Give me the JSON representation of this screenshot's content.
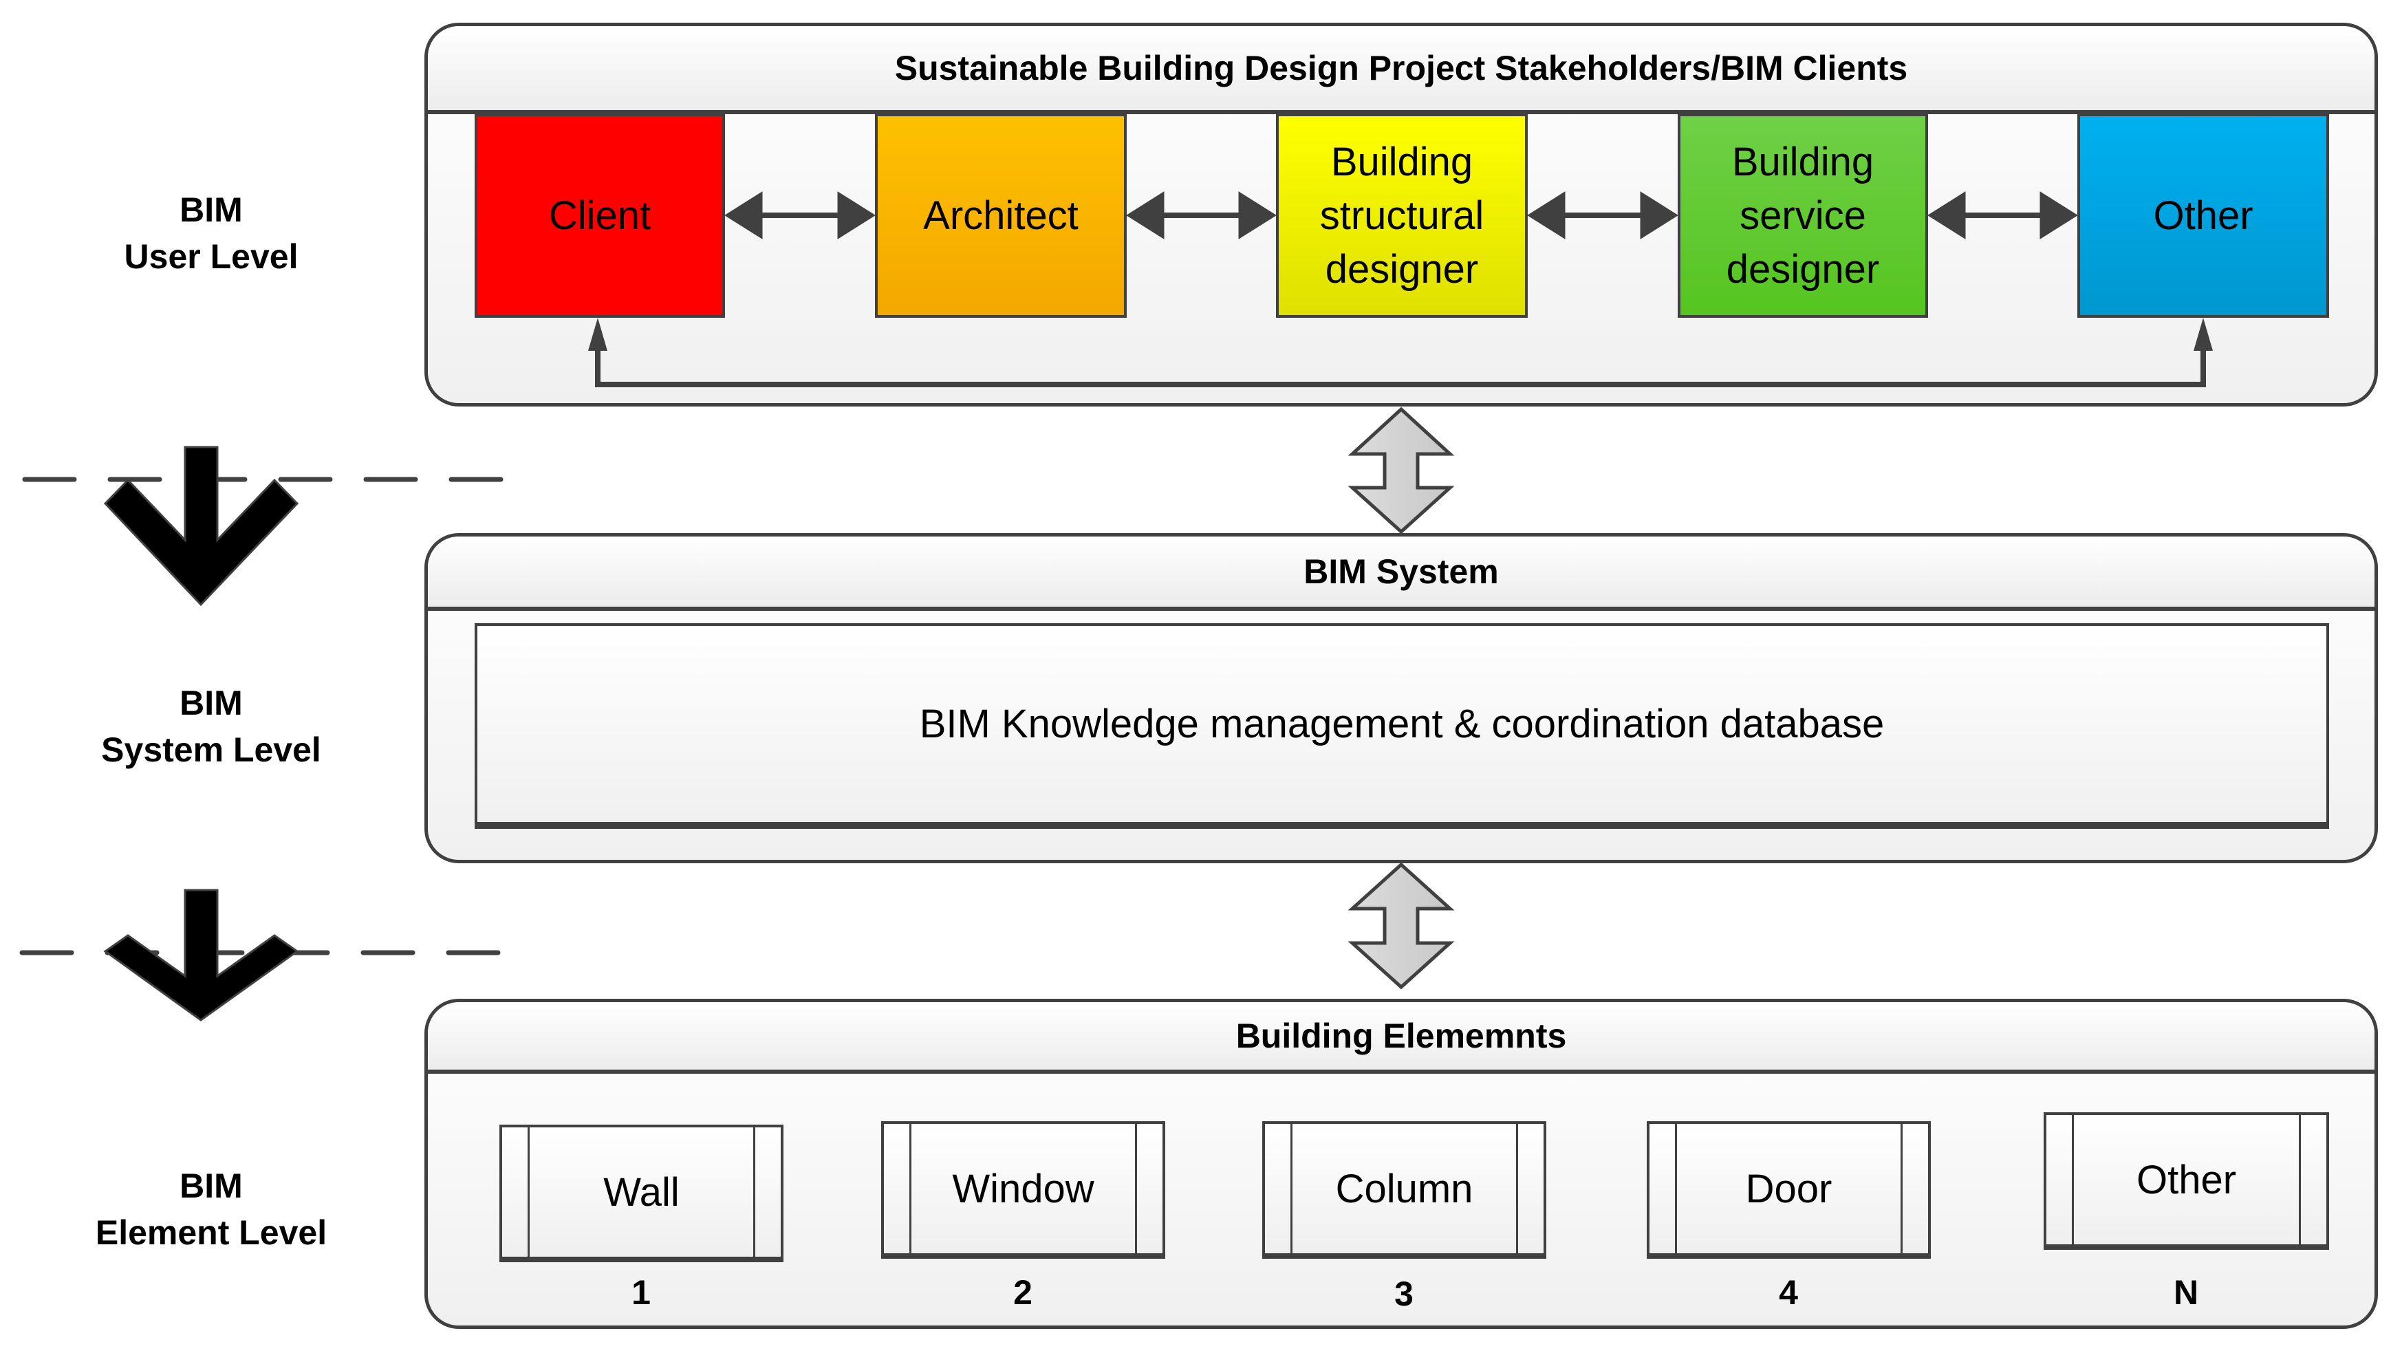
{
  "levels": {
    "user": {
      "line1": "BIM",
      "line2": "User Level"
    },
    "system": {
      "line1": "BIM",
      "line2": "System Level"
    },
    "element": {
      "line1": "BIM",
      "line2": "Element Level"
    }
  },
  "stakeholders_panel": {
    "title": "Sustainable Building Design Project Stakeholders/BIM Clients",
    "boxes": [
      {
        "label": "Client",
        "color_top": "#ff0000",
        "color_bottom": "#ff0000"
      },
      {
        "label": "Architect",
        "color_top": "#ffc000",
        "color_bottom": "#f3a800"
      },
      {
        "label": "Building structural designer",
        "color_top": "#ffff00",
        "color_bottom": "#dfe000"
      },
      {
        "label": "Building service designer",
        "color_top": "#6fd046",
        "color_bottom": "#55c520"
      },
      {
        "label": "Other",
        "color_top": "#00b0f0",
        "color_bottom": "#0097d0"
      }
    ]
  },
  "system_panel": {
    "title": "BIM System",
    "database_label": "BIM Knowledge management & coordination database"
  },
  "elements_panel": {
    "title": "Building Elememnts",
    "elements": [
      {
        "label": "Wall",
        "number": "1"
      },
      {
        "label": "Window",
        "number": "2"
      },
      {
        "label": "Column",
        "number": "3"
      },
      {
        "label": "Door",
        "number": "4"
      },
      {
        "label": "Other",
        "number": "N"
      }
    ]
  },
  "colors": {
    "stroke": "#404040",
    "double_arrow_fill": "#d0d0d0",
    "level_arrow_fill": "#000000"
  }
}
